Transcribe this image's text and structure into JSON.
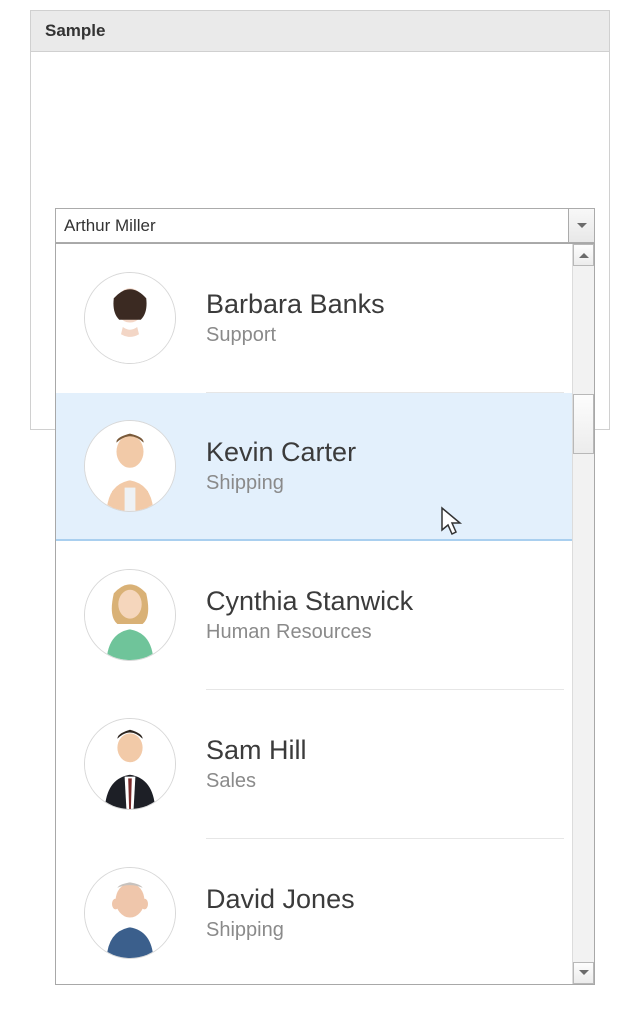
{
  "panel": {
    "title": "Sample"
  },
  "combo": {
    "value": "Arthur Miller"
  },
  "items": [
    {
      "name": "Barbara Banks",
      "dept": "Support",
      "avatar": "female-dark"
    },
    {
      "name": "Kevin Carter",
      "dept": "Shipping",
      "avatar": "male-young",
      "highlight": true
    },
    {
      "name": "Cynthia Stanwick",
      "dept": "Human Resources",
      "avatar": "female-blonde"
    },
    {
      "name": "Sam Hill",
      "dept": "Sales",
      "avatar": "male-suit"
    },
    {
      "name": "David Jones",
      "dept": "Shipping",
      "avatar": "male-bald"
    }
  ]
}
